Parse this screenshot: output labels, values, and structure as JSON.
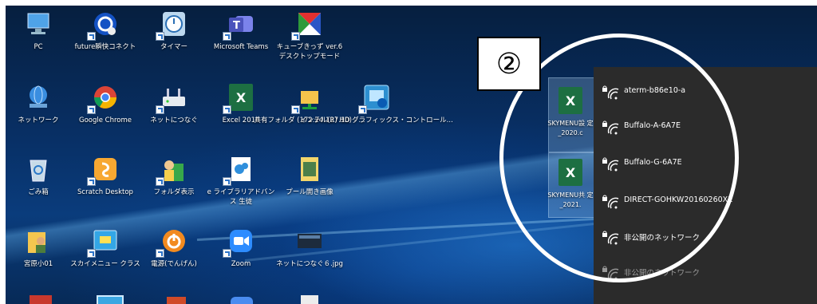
{
  "desktop_icons": [
    {
      "label": "PC",
      "icon": "pc-icon"
    },
    {
      "label": "future瞬快コネクト",
      "icon": "future-connect-icon"
    },
    {
      "label": "タイマー",
      "icon": "timer-icon"
    },
    {
      "label": "Microsoft Teams",
      "icon": "teams-icon"
    },
    {
      "label": "キューブきっず ver.6 デスクトップモード",
      "icon": "cube-kids-icon"
    },
    {
      "label": "ネットワーク",
      "icon": "network-icon"
    },
    {
      "label": "Google Chrome",
      "icon": "chrome-icon"
    },
    {
      "label": "ネットにつなぐ",
      "icon": "net-connect-icon"
    },
    {
      "label": "Excel 2016",
      "icon": "excel-icon"
    },
    {
      "label": "共有フォルダ (172.24.127.10) - ...",
      "icon": "shared-folder-icon"
    },
    {
      "label": "インテル(R) HD グラフィックス・コントロール...",
      "icon": "intel-graphics-icon"
    },
    {
      "label": "ごみ箱",
      "icon": "recycle-bin-icon"
    },
    {
      "label": "Scratch Desktop",
      "icon": "scratch-icon"
    },
    {
      "label": "フォルダ表示",
      "icon": "folder-view-icon"
    },
    {
      "label": "e ライブラリアドバンス 生徒",
      "icon": "e-library-icon"
    },
    {
      "label": "プール開き画像",
      "icon": "pool-image-icon"
    },
    {
      "label": "宮原小01",
      "icon": "user-icon"
    },
    {
      "label": "スカイメニュー クラス",
      "icon": "skymenu-icon"
    },
    {
      "label": "電源(でんげん)",
      "icon": "power-icon"
    },
    {
      "label": "Zoom",
      "icon": "zoom-icon"
    },
    {
      "label": "ネットにつなぐ６.jpg",
      "icon": "image-file-icon"
    }
  ],
  "background_files": [
    {
      "label": "SKYMENU設 定_2020.c"
    },
    {
      "label": "SKYMENU共 定_2021."
    }
  ],
  "wifi_networks": [
    {
      "ssid": "aterm-b86e10-a",
      "secured": true
    },
    {
      "ssid": "Buffalo-A-6A7E",
      "secured": true
    },
    {
      "ssid": "Buffalo-G-6A7E",
      "secured": true
    },
    {
      "ssid": "DIRECT-GOHKW20160260XE",
      "secured": true
    },
    {
      "ssid": "非公開のネットワーク",
      "secured": true
    },
    {
      "ssid": "非公開のネットワーク",
      "secured": true
    }
  ],
  "annotation": {
    "step_label": "②"
  },
  "colors": {
    "panel_bg": "#2b2b2b",
    "wifi_text": "#ffffff",
    "annotation": "#ffffff"
  }
}
